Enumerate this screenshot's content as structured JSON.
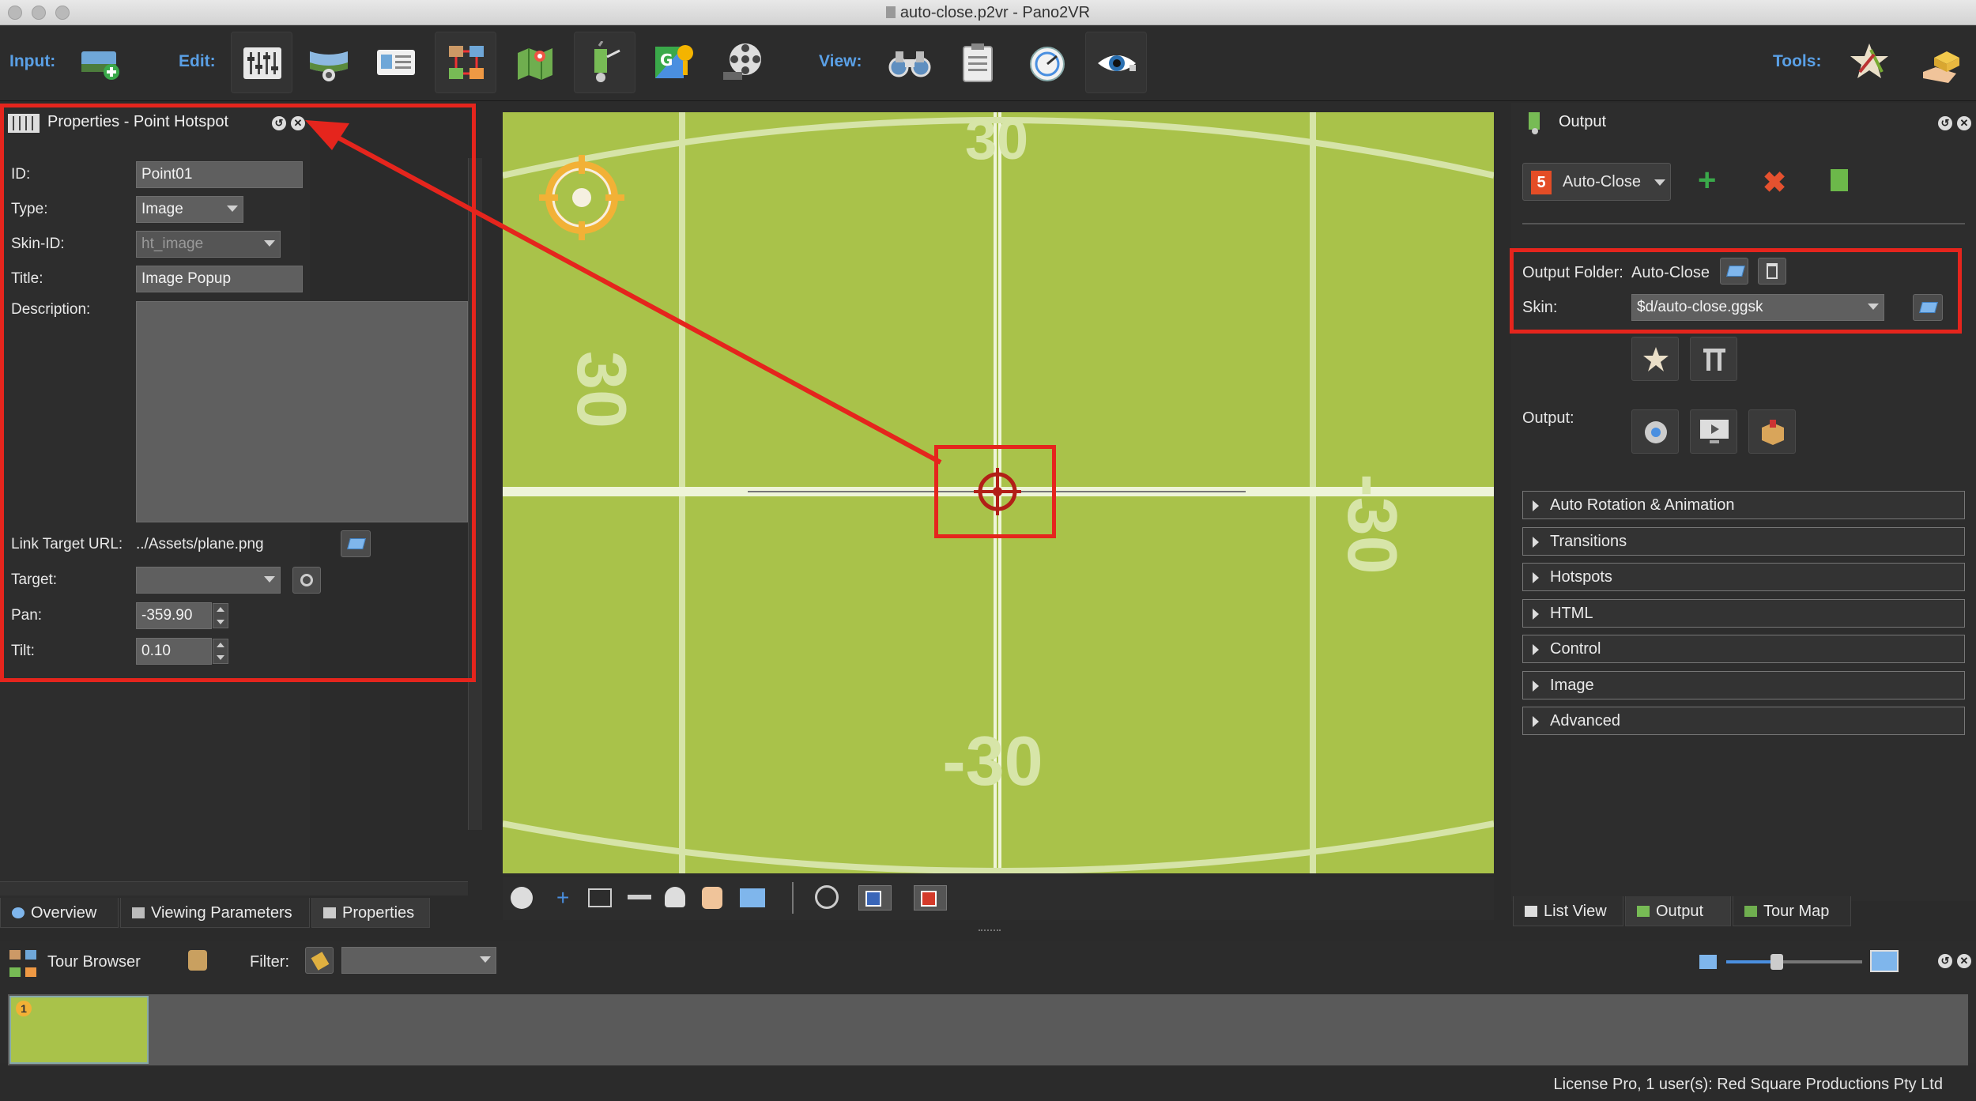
{
  "window": {
    "title": "auto-close.p2vr - Pano2VR"
  },
  "toolbar": {
    "input_label": "Input:",
    "edit_label": "Edit:",
    "view_label": "View:",
    "tools_label": "Tools:",
    "input_icons": [
      "import-panorama-icon"
    ],
    "edit_icons": [
      "viewing-parameters-icon",
      "patches-icon",
      "properties-icon",
      "tour-icon",
      "map-icon",
      "hotspot-icon",
      "google-icon",
      "animation-icon"
    ],
    "view_icons": [
      "binoculars-icon",
      "clipboard-icon",
      "skin-icon",
      "eye-icon"
    ],
    "tools_icons": [
      "star-tools-icon",
      "hand-box-icon"
    ]
  },
  "properties": {
    "header": "Properties - Point Hotspot",
    "id_label": "ID:",
    "id_value": "Point01",
    "type_label": "Type:",
    "type_value": "Image",
    "skin_id_label": "Skin-ID:",
    "skin_id_value": "ht_image",
    "title_label": "Title:",
    "title_value": "Image Popup",
    "description_label": "Description:",
    "link_label": "Link Target URL:",
    "link_value": "../Assets/plane.png",
    "target_label": "Target:",
    "target_value": "",
    "pan_label": "Pan:",
    "pan_value": "-359.90",
    "tilt_label": "Tilt:",
    "tilt_value": "0.10"
  },
  "left_tabs": [
    "Overview",
    "Viewing Parameters",
    "Properties"
  ],
  "viewer": {
    "grid_labels": [
      "30",
      "30",
      "-30",
      "-30"
    ],
    "bg_color": "#a9c24a"
  },
  "output": {
    "header": "Output",
    "format": "Auto-Close",
    "folder_label": "Output Folder:",
    "folder_value": "Auto-Close",
    "skin_label": "Skin:",
    "skin_value": "$d/auto-close.ggsk",
    "output_label": "Output:",
    "sections": [
      "Auto Rotation & Animation",
      "Transitions",
      "Hotspots",
      "HTML",
      "Control",
      "Image",
      "Advanced"
    ]
  },
  "right_tabs": [
    "List View",
    "Output",
    "Tour Map"
  ],
  "tour_browser": {
    "title": "Tour Browser",
    "filter_label": "Filter:",
    "filter_value": "",
    "thumb_number": "1"
  },
  "status": {
    "text": "License Pro, 1 user(s): Red Square Productions Pty Ltd"
  },
  "colors": {
    "accent_blue": "#5aa0e6",
    "annotation_red": "#e5251d",
    "panel_bg": "#2d2d2d"
  }
}
